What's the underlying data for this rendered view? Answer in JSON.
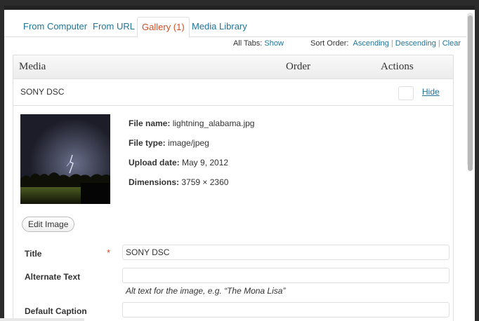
{
  "tabs": [
    {
      "label": "From Computer",
      "active": false
    },
    {
      "label": "From URL",
      "active": false
    },
    {
      "label": "Gallery (1)",
      "active": true
    },
    {
      "label": "Media Library",
      "active": false
    }
  ],
  "toolbar": {
    "all_tabs_label": "All Tabs:",
    "show_link": "Show",
    "sort_order_label": "Sort Order:",
    "ascending": "Ascending",
    "descending": "Descending",
    "clear": "Clear",
    "separator": "|"
  },
  "table": {
    "headers": {
      "media": "Media",
      "order": "Order",
      "actions": "Actions"
    },
    "item": {
      "title": "SONY DSC",
      "hide_label": "Hide",
      "file_name_label": "File name:",
      "file_name": "lightning_alabama.jpg",
      "file_type_label": "File type:",
      "file_type": "image/jpeg",
      "upload_date_label": "Upload date:",
      "upload_date": "May 9, 2012",
      "dimensions_label": "Dimensions:",
      "dimensions": "3759 × 2360",
      "edit_image_label": "Edit Image"
    }
  },
  "form": {
    "title_label": "Title",
    "title_required_mark": "*",
    "title_value": "SONY DSC",
    "alt_label": "Alternate Text",
    "alt_value": "",
    "alt_help": "Alt text for the image, e.g. “The Mona Lisa”",
    "caption_label": "Default Caption",
    "caption_value": ""
  },
  "colors": {
    "link": "#21759b",
    "active_tab": "#d54e21",
    "required": "#d54e21"
  }
}
